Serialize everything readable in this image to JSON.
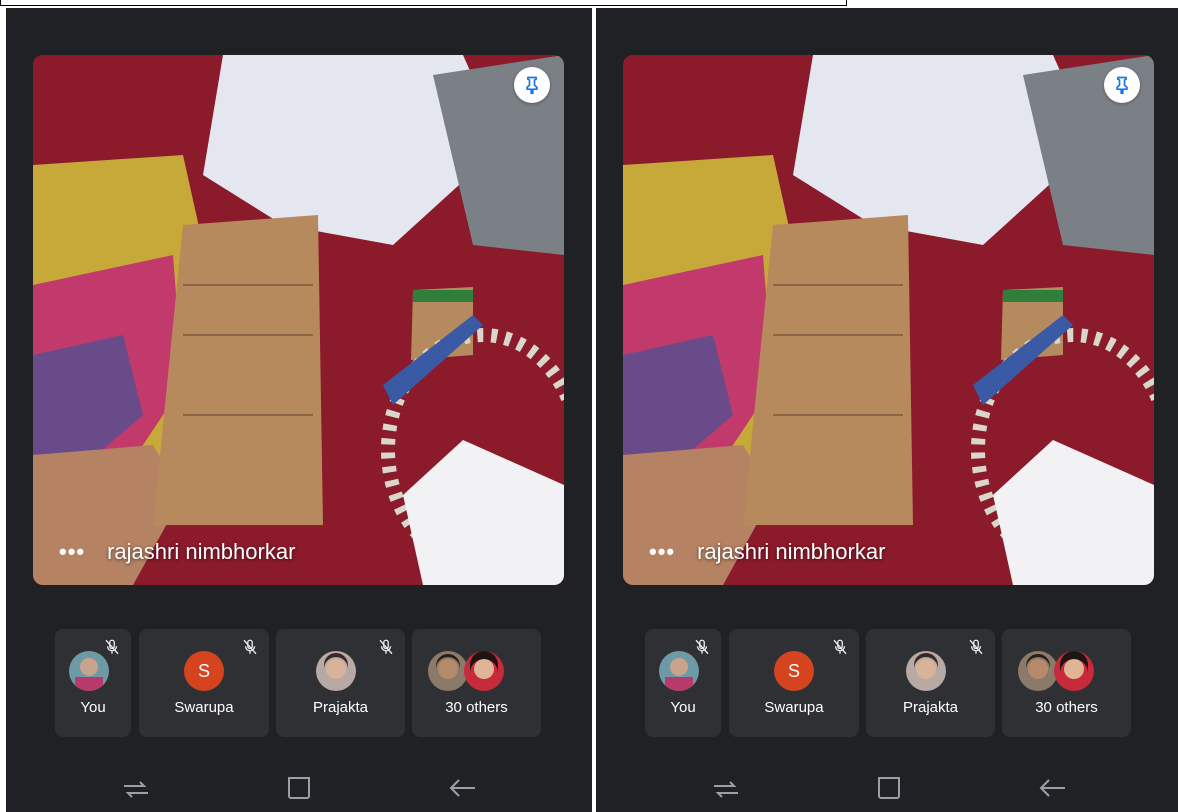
{
  "speaker": {
    "name": "rajashri nimbhorkar",
    "more_label": "•••"
  },
  "participants": [
    {
      "label": "You",
      "muted": true,
      "avatar": "photo"
    },
    {
      "label": "Swarupa",
      "muted": true,
      "avatar": "letter",
      "initial": "S",
      "color": "#d5431f"
    },
    {
      "label": "Prajakta",
      "muted": true,
      "avatar": "photo"
    },
    {
      "label": "30 others",
      "muted": false,
      "avatar": "stack"
    }
  ],
  "icons": {
    "pin": "pin-icon",
    "more": "more-horizontal-icon",
    "mic_off": "mic-off-icon",
    "nav_recents": "recents-icon",
    "nav_home": "home-icon",
    "nav_back": "back-arrow-icon"
  },
  "colors": {
    "background": "#202124",
    "card": "#2f3033",
    "accent": "#1a73e8",
    "avatar_s": "#d5431f"
  }
}
